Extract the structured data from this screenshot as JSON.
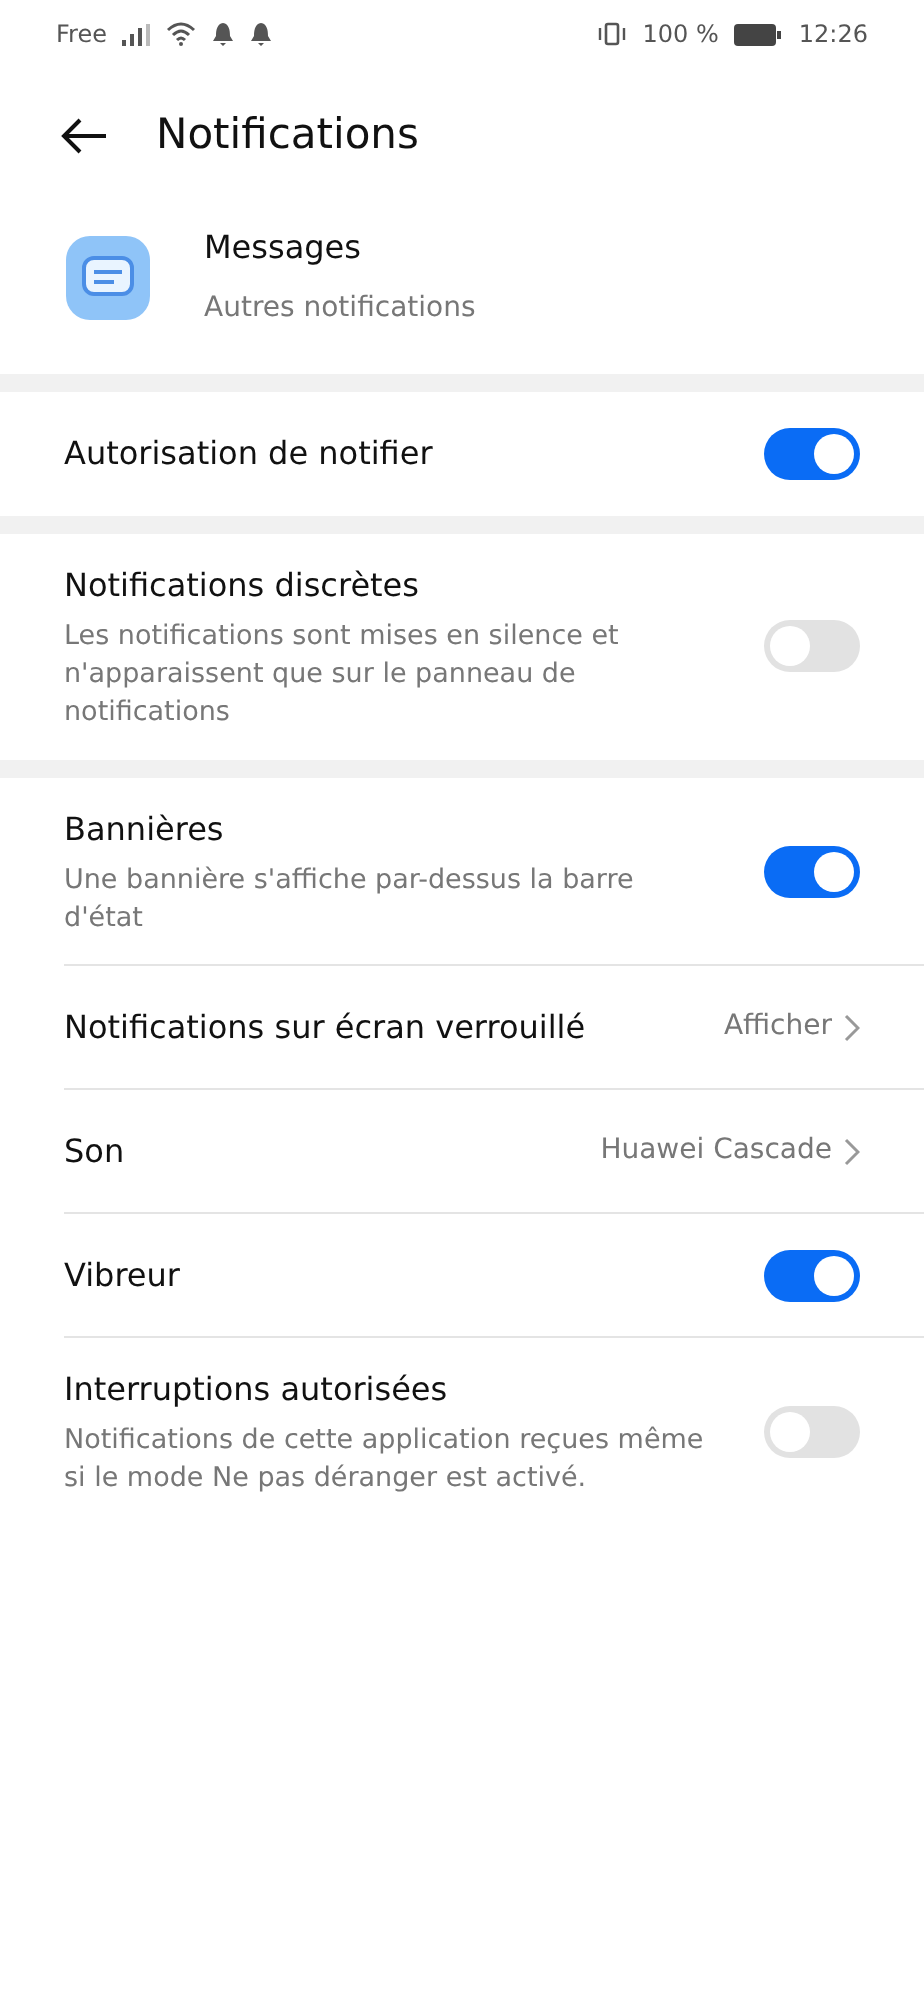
{
  "status_bar": {
    "carrier": "Free",
    "battery": "100 %",
    "time": "12:26"
  },
  "header": {
    "title": "Notifications"
  },
  "app": {
    "name": "Messages",
    "subtitle": "Autres notifications"
  },
  "sections": [
    {
      "rows": [
        {
          "kind": "toggle",
          "title": "Autorisation de notifier",
          "on": true
        }
      ]
    },
    {
      "rows": [
        {
          "kind": "toggle",
          "title": "Notifications discrètes",
          "description": "Les notifications sont mises en silence et n'apparaissent que sur le panneau de notifications",
          "on": false
        }
      ]
    },
    {
      "rows": [
        {
          "kind": "toggle",
          "title": "Bannières",
          "description": "Une bannière s'affiche par-dessus la barre d'état",
          "on": true
        },
        {
          "kind": "value",
          "title": "Notifications sur écran verrouillé",
          "value": "Afficher"
        },
        {
          "kind": "value",
          "title": "Son",
          "value": "Huawei Cascade"
        },
        {
          "kind": "toggle",
          "title": "Vibreur",
          "on": true
        },
        {
          "kind": "toggle",
          "title": "Interruptions autorisées",
          "description": "Notifications de cette application reçues même si le mode Ne pas déranger est activé.",
          "on": false
        }
      ]
    }
  ]
}
